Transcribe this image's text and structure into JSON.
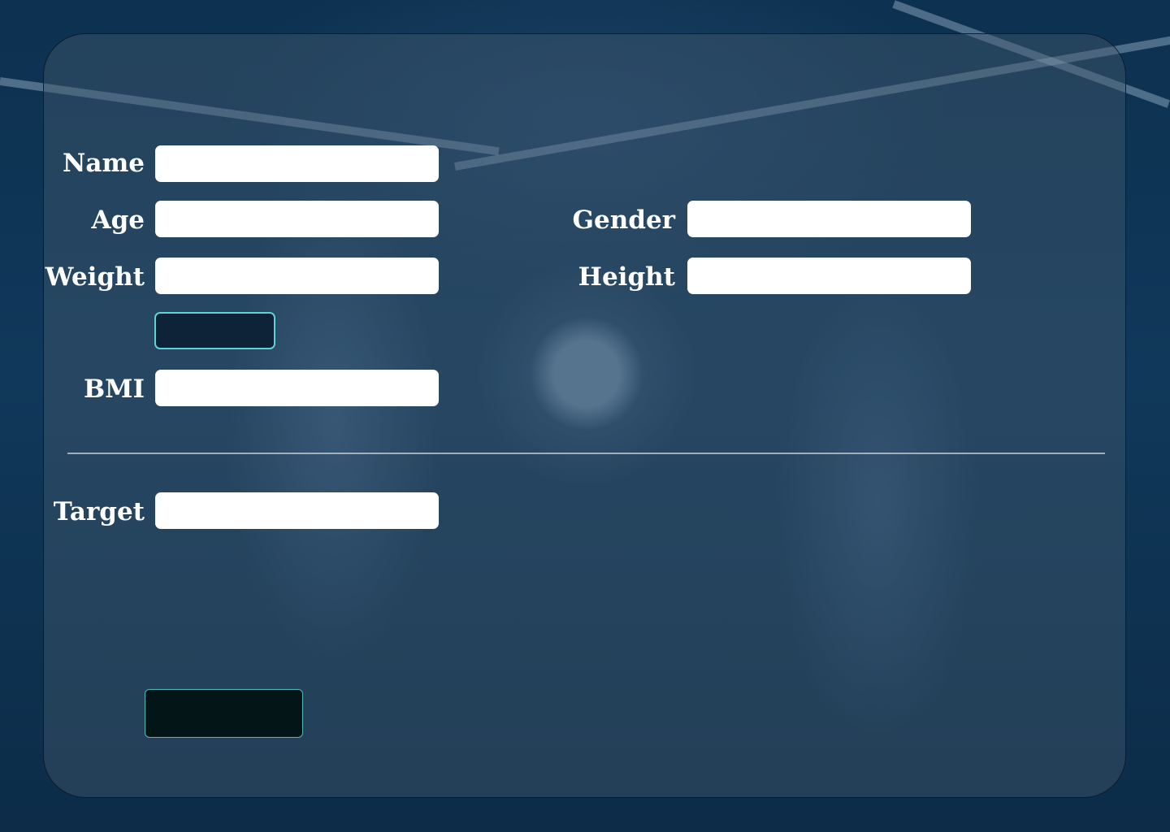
{
  "form": {
    "name_label": "Name",
    "age_label": "Age",
    "gender_label": "Gender",
    "weight_label": "Weight",
    "height_label": "Height",
    "bmi_label": "BMI",
    "target_label": "Target",
    "name_value": "",
    "age_value": "",
    "gender_value": "",
    "weight_value": "",
    "height_value": "",
    "bmi_value": "",
    "target_value": ""
  },
  "buttons": {
    "calculate_label": "",
    "submit_label": ""
  },
  "colors": {
    "accent": "#5ed3d3",
    "button_dark": "#0e2238",
    "submit_dark": "#041517"
  }
}
